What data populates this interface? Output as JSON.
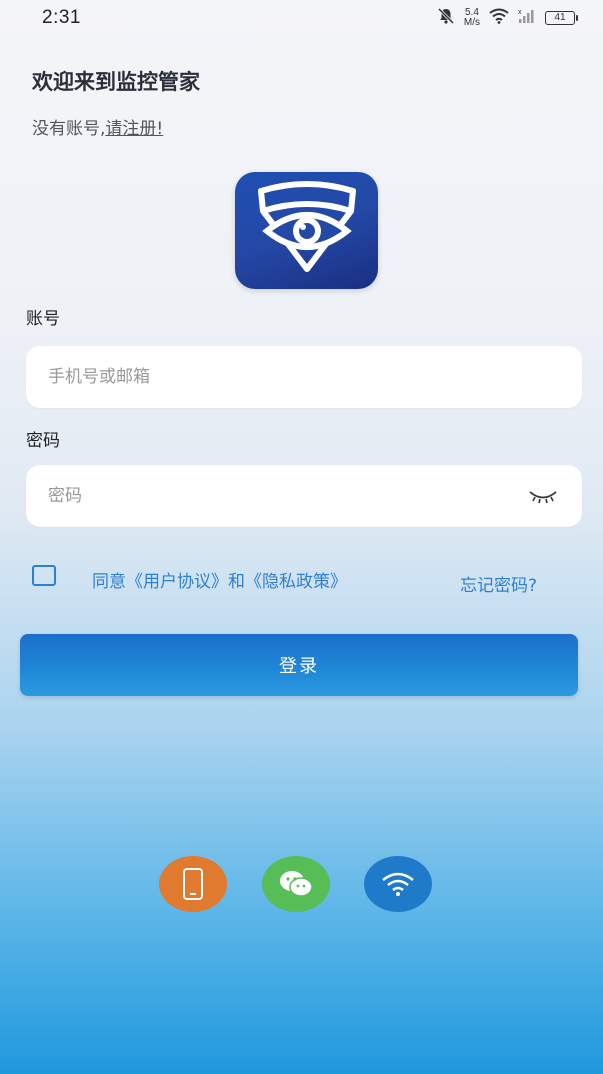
{
  "status_bar": {
    "time": "2:31",
    "net_speed_value": "5.4",
    "net_speed_unit": "M/s",
    "battery": "41",
    "icons": [
      "bell-muted-icon",
      "wifi-icon",
      "signal-icon",
      "battery-icon"
    ]
  },
  "header": {
    "welcome": "欢迎来到监控管家",
    "no_account": "没有账号,",
    "register_link": "请注册!"
  },
  "logo": {
    "icon": "eye-shield-logo"
  },
  "account": {
    "label": "账号",
    "placeholder": "手机号或邮箱"
  },
  "password": {
    "label": "密码",
    "placeholder": "密码",
    "toggle_icon": "eye-closed-icon"
  },
  "agreement": {
    "checked": false,
    "text": "同意《用户协议》和《隐私政策》",
    "forgot": "忘记密码?"
  },
  "login_button": {
    "label": "登录"
  },
  "third_party_login": [
    {
      "icon": "phone-icon",
      "color": "#e07a2e"
    },
    {
      "icon": "wechat-icon",
      "color": "#57bd57"
    },
    {
      "icon": "wifi-icon",
      "color": "#1f7bc9"
    }
  ],
  "colors": {
    "accent": "#2f7fd0",
    "button": "#1f86d6",
    "logo_bg": "#2448a6"
  }
}
